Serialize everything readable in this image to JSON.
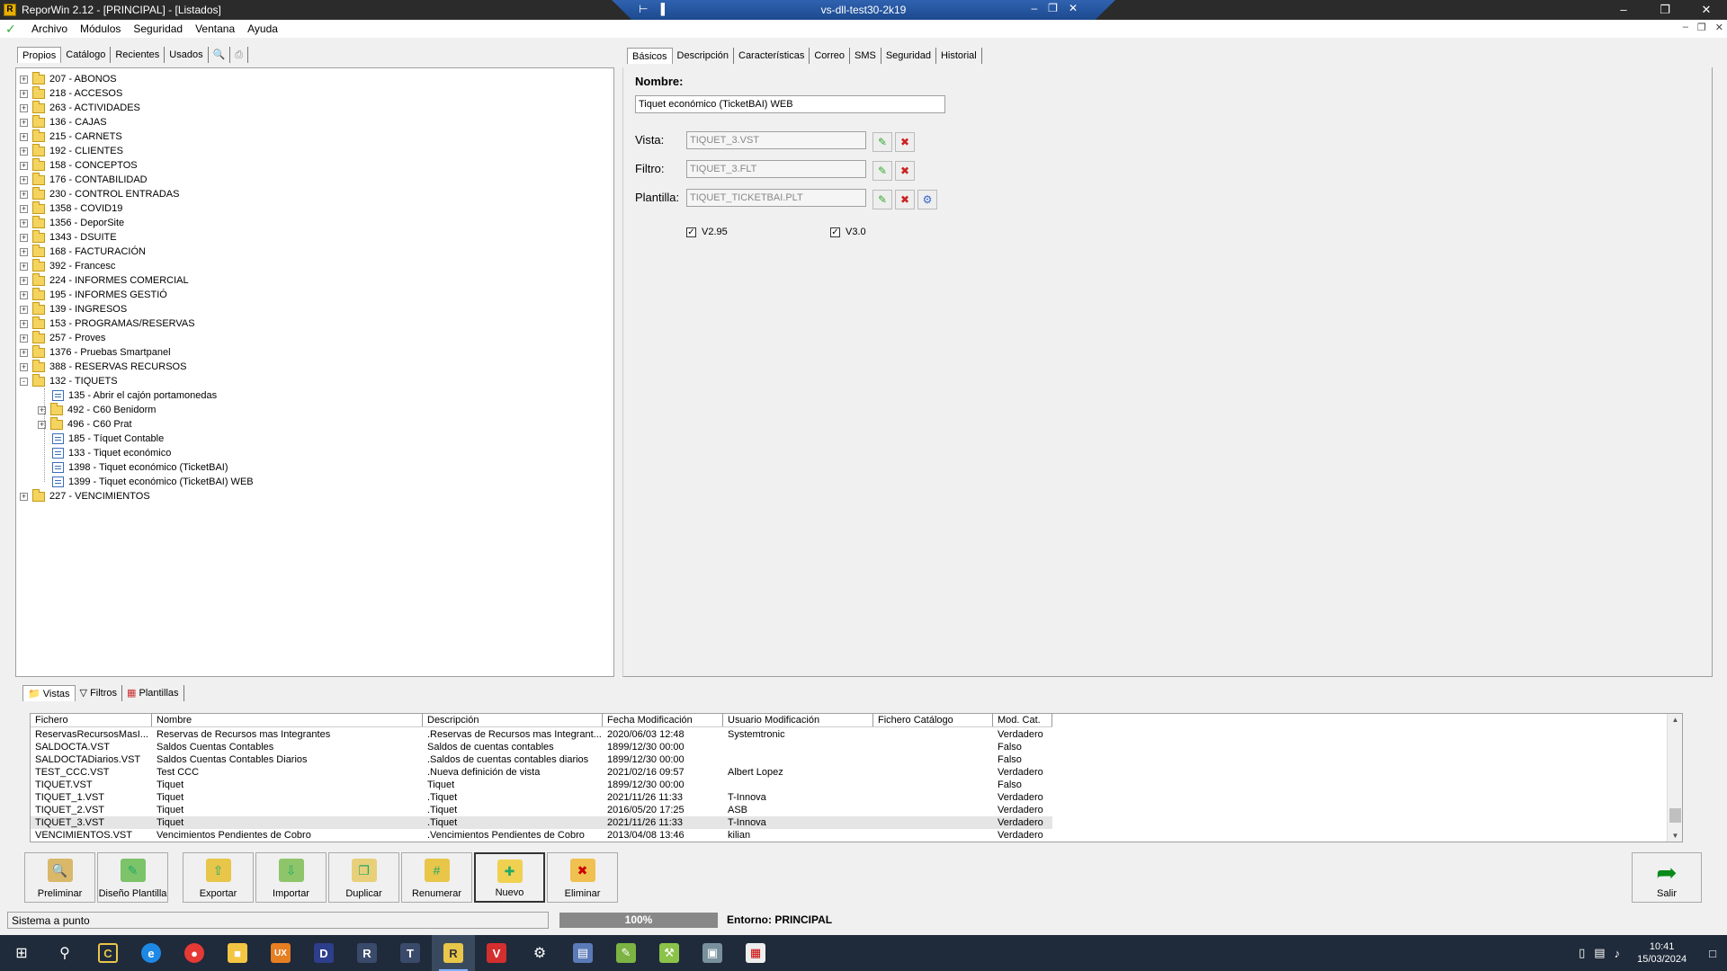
{
  "window": {
    "title": "ReporWin 2.12 - [PRINCIPAL] - [Listados]",
    "rdp_title": "vs-dll-test30-2k19"
  },
  "menu": [
    "Archivo",
    "Módulos",
    "Seguridad",
    "Ventana",
    "Ayuda"
  ],
  "left_tabs": [
    "Propios",
    "Catálogo",
    "Recientes",
    "Usados"
  ],
  "tree": [
    {
      "label": "207 - ABONOS",
      "level": 0,
      "type": "folder",
      "exp": "+"
    },
    {
      "label": "218 - ACCESOS",
      "level": 0,
      "type": "folder",
      "exp": "+"
    },
    {
      "label": "263 - ACTIVIDADES",
      "level": 0,
      "type": "folder",
      "exp": "+"
    },
    {
      "label": "136 - CAJAS",
      "level": 0,
      "type": "folder",
      "exp": "+"
    },
    {
      "label": "215 - CARNETS",
      "level": 0,
      "type": "folder",
      "exp": "+"
    },
    {
      "label": "192 - CLIENTES",
      "level": 0,
      "type": "folder",
      "exp": "+"
    },
    {
      "label": "158 - CONCEPTOS",
      "level": 0,
      "type": "folder",
      "exp": "+"
    },
    {
      "label": "176 - CONTABILIDAD",
      "level": 0,
      "type": "folder",
      "exp": "+"
    },
    {
      "label": "230 - CONTROL ENTRADAS",
      "level": 0,
      "type": "folder",
      "exp": "+"
    },
    {
      "label": "1358 - COVID19",
      "level": 0,
      "type": "folder",
      "exp": "+"
    },
    {
      "label": "1356 - DeporSite",
      "level": 0,
      "type": "folder",
      "exp": "+"
    },
    {
      "label": "1343 - DSUITE",
      "level": 0,
      "type": "folder",
      "exp": "+"
    },
    {
      "label": "168 - FACTURACIÓN",
      "level": 0,
      "type": "folder",
      "exp": "+"
    },
    {
      "label": "392 - Francesc",
      "level": 0,
      "type": "folder",
      "exp": "+"
    },
    {
      "label": "224 - INFORMES COMERCIAL",
      "level": 0,
      "type": "folder",
      "exp": "+"
    },
    {
      "label": "195 - INFORMES GESTIÓ",
      "level": 0,
      "type": "folder",
      "exp": "+"
    },
    {
      "label": "139 - INGRESOS",
      "level": 0,
      "type": "folder",
      "exp": "+"
    },
    {
      "label": "153 - PROGRAMAS/RESERVAS",
      "level": 0,
      "type": "folder",
      "exp": "+"
    },
    {
      "label": "257 - Proves",
      "level": 0,
      "type": "folder",
      "exp": "+"
    },
    {
      "label": "1376 - Pruebas Smartpanel",
      "level": 0,
      "type": "folder",
      "exp": "+"
    },
    {
      "label": "388 - RESERVAS RECURSOS",
      "level": 0,
      "type": "folder",
      "exp": "+"
    },
    {
      "label": "132 - TIQUETS",
      "level": 0,
      "type": "folder",
      "exp": "-"
    },
    {
      "label": "135 - Abrir el cajón portamonedas",
      "level": 1,
      "type": "doc",
      "exp": ""
    },
    {
      "label": "492 - C60 Benidorm",
      "level": 1,
      "type": "folder",
      "exp": "+"
    },
    {
      "label": "496 - C60 Prat",
      "level": 1,
      "type": "folder",
      "exp": "+"
    },
    {
      "label": "185 - Tíquet Contable",
      "level": 1,
      "type": "doc",
      "exp": ""
    },
    {
      "label": "133 - Tiquet económico",
      "level": 1,
      "type": "doc",
      "exp": ""
    },
    {
      "label": "1398 - Tiquet económico (TicketBAI)",
      "level": 1,
      "type": "doc",
      "exp": ""
    },
    {
      "label": "1399 - Tiquet económico (TicketBAI) WEB",
      "level": 1,
      "type": "doc",
      "exp": ""
    },
    {
      "label": "227 - VENCIMIENTOS",
      "level": 0,
      "type": "folder",
      "exp": "+"
    }
  ],
  "right_tabs": [
    "Básicos",
    "Descripción",
    "Características",
    "Correo",
    "SMS",
    "Seguridad",
    "Historial"
  ],
  "form": {
    "nombre_label": "Nombre:",
    "nombre_value": "Tiquet económico (TicketBAI) WEB",
    "vista_label": "Vista:",
    "vista_value": "TIQUET_3.VST",
    "filtro_label": "Filtro:",
    "filtro_value": "TIQUET_3.FLT",
    "plantilla_label": "Plantilla:",
    "plantilla_value": "TIQUET_TICKETBAI.PLT",
    "chk1_label": "V2.95",
    "chk2_label": "V3.0"
  },
  "bottom_tabs": [
    "Vistas",
    "Filtros",
    "Plantillas"
  ],
  "grid": {
    "columns": [
      "Fichero",
      "Nombre",
      "Descripción",
      "Fecha Modificación",
      "Usuario Modificación",
      "Fichero Catálogo",
      "Mod. Cat."
    ],
    "rows": [
      [
        "ReservasRecursosMasI...",
        "Reservas de Recursos mas Integrantes",
        ".Reservas de Recursos mas Integrant...",
        "2020/06/03 12:48",
        "Systemtronic",
        "",
        "Verdadero"
      ],
      [
        "SALDOCTA.VST",
        "Saldos Cuentas Contables",
        "Saldos de cuentas contables",
        "1899/12/30 00:00",
        "",
        "",
        "Falso"
      ],
      [
        "SALDOCTADiarios.VST",
        "Saldos Cuentas Contables Diarios",
        ".Saldos de cuentas contables diarios",
        "1899/12/30 00:00",
        "",
        "",
        "Falso"
      ],
      [
        "TEST_CCC.VST",
        "Test CCC",
        ".Nueva definición de vista",
        "2021/02/16 09:57",
        "Albert Lopez",
        "",
        "Verdadero"
      ],
      [
        "TIQUET.VST",
        "Tiquet",
        "Tiquet",
        "1899/12/30 00:00",
        "",
        "",
        "Falso"
      ],
      [
        "TIQUET_1.VST",
        "Tiquet",
        ".Tiquet",
        "2021/11/26 11:33",
        "T-Innova",
        "",
        "Verdadero"
      ],
      [
        "TIQUET_2.VST",
        "Tiquet",
        ".Tiquet",
        "2016/05/20 17:25",
        "ASB",
        "",
        "Verdadero"
      ],
      [
        "TIQUET_3.VST",
        "Tiquet",
        ".Tiquet",
        "2021/11/26 11:33",
        "T-Innova",
        "",
        "Verdadero"
      ],
      [
        "VENCIMIENTOS.VST",
        "Vencimientos Pendientes de Cobro",
        ".Vencimientos Pendientes de Cobro",
        "2013/04/08 13:46",
        "kilian",
        "",
        "Verdadero"
      ]
    ],
    "selected_row": 7
  },
  "toolbar": [
    {
      "label": "Preliminar",
      "color": "#d9b86a"
    },
    {
      "label": "Diseño Plantilla",
      "color": "#7cc36a"
    },
    {
      "label": "Exportar",
      "color": "#e8c64a"
    },
    {
      "label": "Importar",
      "color": "#8fc56a"
    },
    {
      "label": "Duplicar",
      "color": "#e8cf7a"
    },
    {
      "label": "Renumerar",
      "color": "#e8c64a"
    },
    {
      "label": "Nuevo",
      "color": "#f0d050"
    },
    {
      "label": "Eliminar",
      "color": "#f0c050"
    }
  ],
  "salir_label": "Salir",
  "status": {
    "message": "Sistema a punto",
    "progress_label": "100%",
    "progress": 100,
    "entorno": "Entorno: PRINCIPAL"
  },
  "taskbar": {
    "time": "10:41",
    "date": "15/03/2024"
  }
}
